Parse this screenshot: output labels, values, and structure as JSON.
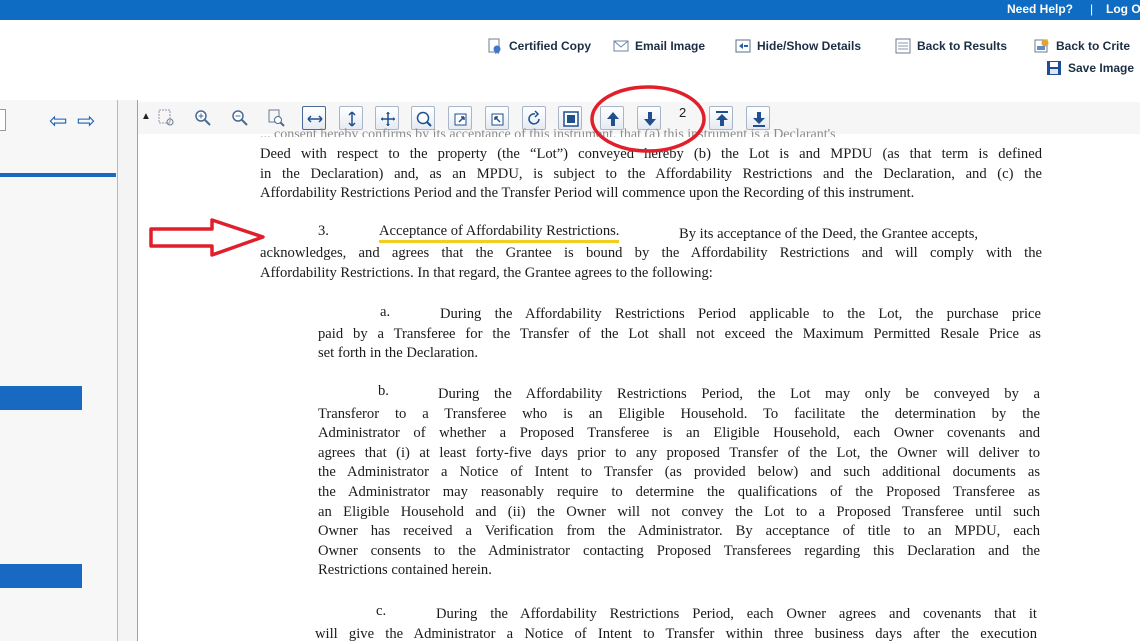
{
  "top_bar": {
    "help": "Need Help?",
    "separator": "|",
    "logout": "Log O"
  },
  "actions": {
    "certified_copy": "Certified Copy",
    "email_image": "Email Image",
    "hide_show_details": "Hide/Show Details",
    "back_to_results": "Back to Results",
    "back_to_criteria": "Back to Crite",
    "save_image": "Save Image"
  },
  "viewer": {
    "page_number": "2",
    "collapse_glyph": "▲"
  },
  "document": {
    "top_cut_line": "... consent hereby confirms by its acceptance of this instrument, that (a) this instrument is a Declarant's",
    "intro_lines": [
      "Deed with respect to the property (the “Lot”) conveyed hereby (b) the Lot is and MPDU (as that term is defined",
      "in the Declaration) and, as an MPDU, is subject to the Affordability Restrictions and the Declaration, and (c) the",
      "Affordability Restrictions Period and the Transfer Period will commence upon the Recording of this instrument."
    ],
    "section3_number": "3.",
    "section3_heading": "Acceptance of Affordability Restrictions.",
    "section3_first": "By its acceptance of the Deed, the Grantee accepts,",
    "section3_lines": [
      "acknowledges, and agrees that the Grantee is bound by the Affordability Restrictions and will comply with the",
      "Affordability Restrictions. In that regard, the Grantee agrees to the following:"
    ],
    "item_a_label": "a.",
    "item_a_lines": [
      "During the Affordability Restrictions Period applicable to the Lot, the purchase price",
      "paid by a Transferee for the Transfer of the Lot shall not exceed the Maximum Permitted Resale Price as",
      "set forth in the Declaration."
    ],
    "item_b_label": "b.",
    "item_b_lines": [
      "During the Affordability Restrictions Period, the Lot may only be conveyed by a",
      "Transferor to a Transferee who is an Eligible Household.  To facilitate the determination by the",
      "Administrator of whether a Proposed Transferee is an Eligible Household, each Owner covenants and",
      "agrees that (i) at least forty-five days prior to any proposed Transfer of the Lot, the Owner will deliver to",
      "the Administrator a Notice of Intent to Transfer (as provided below) and such additional documents as",
      "the Administrator may reasonably require to determine the qualifications of the Proposed Transferee as",
      "an Eligible Household and (ii) the Owner will not convey the Lot to a Proposed Transferee until such",
      "Owner has received a Verification from the Administrator.  By acceptance of title to an MPDU, each",
      "Owner consents to the Administrator contacting Proposed Transferees regarding this Declaration and the",
      "Restrictions contained herein."
    ],
    "item_c_label": "c.",
    "item_c_lines": [
      "During the Affordability Restrictions Period, each Owner agrees and covenants that it",
      "will give the Administrator a Notice of Intent to Transfer within three business days after the execution"
    ]
  },
  "colors": {
    "top_bar": "#0e6cc2",
    "annotation_red": "#e01f2a",
    "highlight_yellow": "#f2cf1e",
    "left_blocks": "#1769c1"
  }
}
